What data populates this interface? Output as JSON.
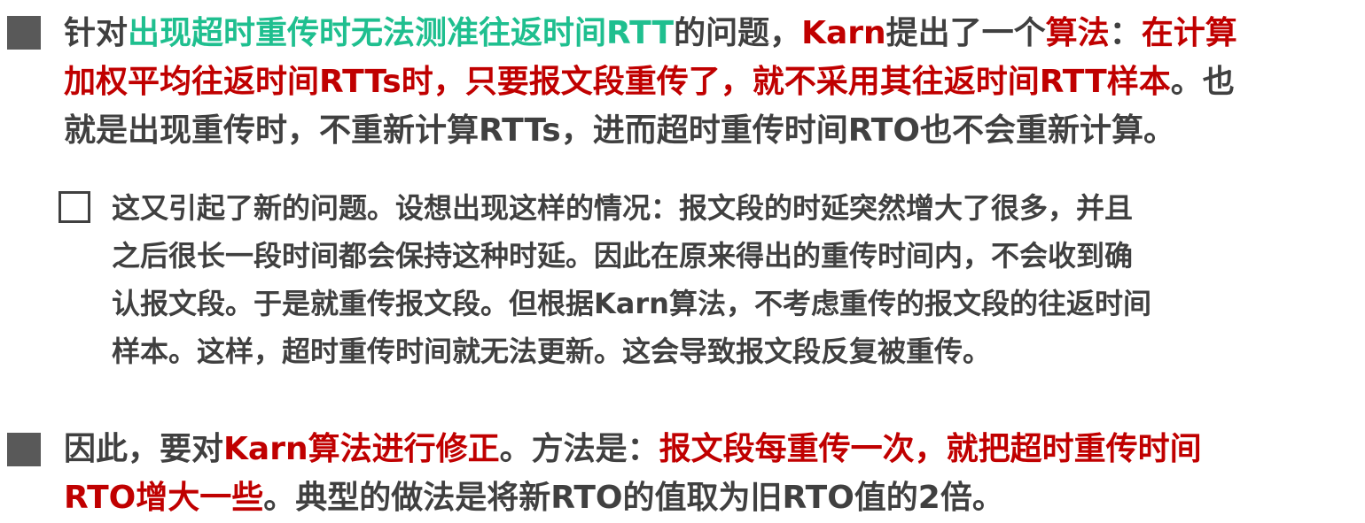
{
  "colors": {
    "teal": "#1fbf8f",
    "red": "#c00000",
    "text": "#404040",
    "bullet": "#595959"
  },
  "paragraphs": [
    {
      "bullet": "filled-square-icon",
      "lines": [
        [
          {
            "t": "针对",
            "c": "plain"
          },
          {
            "t": "出现超时重传时无法测准往返时间RTT",
            "c": "teal"
          },
          {
            "t": "的问题，",
            "c": "plain"
          },
          {
            "t": "Karn",
            "c": "red"
          },
          {
            "t": "提出了一个",
            "c": "plain"
          },
          {
            "t": "算法",
            "c": "red"
          },
          {
            "t": "：",
            "c": "plain"
          },
          {
            "t": "在计算",
            "c": "red"
          }
        ],
        [
          {
            "t": "加权平均往返时间RTTs时，只要报文段重传了，就不采用其往返时间RTT样本",
            "c": "red"
          },
          {
            "t": "。也",
            "c": "plain"
          }
        ],
        [
          {
            "t": "就是出现重传时，不重新计算RTTs，进而超时重传时间RTO也不会重新计算。",
            "c": "plain"
          }
        ]
      ]
    },
    {
      "bullet": "empty-square-icon",
      "lines": [
        [
          {
            "t": "这又引起了新的问题。设想出现这样的情况：报文段的时延突然增大了很多，并且",
            "c": "plain"
          }
        ],
        [
          {
            "t": "之后很长一段时间都会保持这种时延。因此在原来得出的重传时间内，不会收到确",
            "c": "plain"
          }
        ],
        [
          {
            "t": "认报文段。于是就重传报文段。但根据Karn算法，不考虑重传的报文段的往返时间",
            "c": "plain"
          }
        ],
        [
          {
            "t": "样本。这样，超时重传时间就无法更新。这会导致报文段反复被重传。",
            "c": "plain"
          }
        ]
      ]
    },
    {
      "bullet": "filled-square-icon",
      "lines": [
        [
          {
            "t": "因此，要对",
            "c": "plain"
          },
          {
            "t": "Karn算法进行修正",
            "c": "red"
          },
          {
            "t": "。方法是：",
            "c": "plain"
          },
          {
            "t": "报文段每重传一次，就把超时重传时间",
            "c": "red"
          }
        ],
        [
          {
            "t": "RTO增大一些",
            "c": "red"
          },
          {
            "t": "。典型的做法是将新RTO的值取为旧RTO值的2倍。",
            "c": "plain"
          }
        ]
      ]
    }
  ]
}
